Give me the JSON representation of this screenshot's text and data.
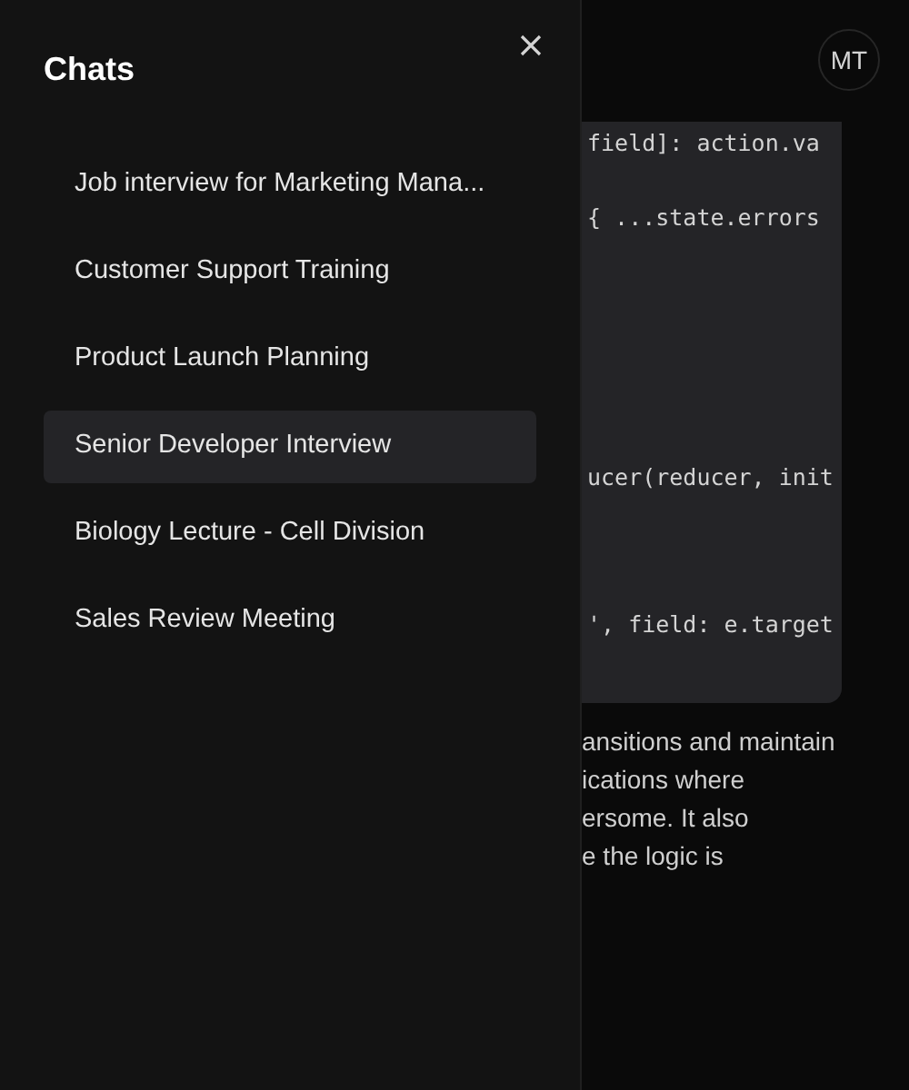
{
  "drawer": {
    "title": "Chats",
    "items": [
      {
        "label": "Job interview for Marketing Mana...",
        "selected": false
      },
      {
        "label": "Customer Support Training",
        "selected": false
      },
      {
        "label": "Product Launch Planning",
        "selected": false
      },
      {
        "label": "Senior Developer Interview",
        "selected": true
      },
      {
        "label": "Biology Lecture - Cell Division",
        "selected": false
      },
      {
        "label": "Sales Review Meeting",
        "selected": false
      }
    ]
  },
  "header": {
    "avatar": "MT"
  },
  "code_lines": [
    "field]: action.va",
    "{ ...state.errors",
    "ucer(reducer, init",
    "', field: e.target"
  ],
  "paragraph_lines": [
    "ansitions and maintain",
    "ications where",
    "ersome. It also",
    "e the logic is"
  ]
}
